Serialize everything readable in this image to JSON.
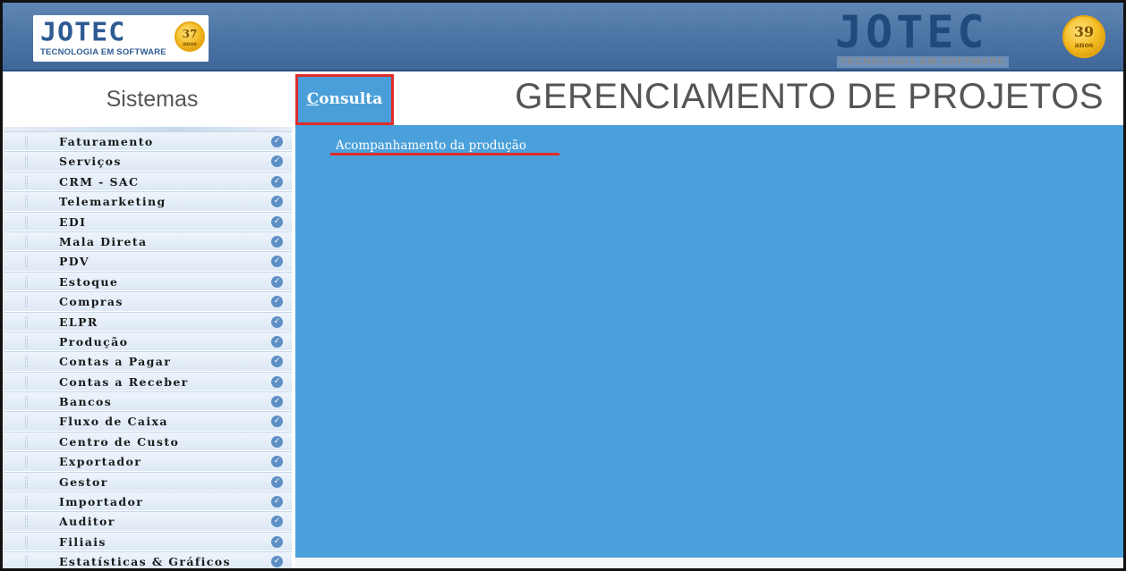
{
  "header": {
    "logo_left": {
      "brand": "JOTEC",
      "tagline": "TECNOLOGIA EM SOFTWARE",
      "badge_number": "37",
      "badge_text": "anos"
    },
    "logo_right": {
      "brand": "JOTEC",
      "tagline": "TECNOLOGIA EM SOFTWARE",
      "badge_number": "39",
      "badge_text": "anos"
    }
  },
  "sidebar": {
    "title": "Sistemas",
    "items": [
      {
        "label": "Faturamento"
      },
      {
        "label": "Serviços"
      },
      {
        "label": "CRM - SAC"
      },
      {
        "label": "Telemarketing"
      },
      {
        "label": "EDI"
      },
      {
        "label": "Mala Direta"
      },
      {
        "label": "PDV"
      },
      {
        "label": "Estoque"
      },
      {
        "label": "Compras"
      },
      {
        "label": "ELPR"
      },
      {
        "label": "Produção"
      },
      {
        "label": "Contas a Pagar"
      },
      {
        "label": "Contas a Receber"
      },
      {
        "label": "Bancos"
      },
      {
        "label": "Fluxo de Caixa"
      },
      {
        "label": "Centro de Custo"
      },
      {
        "label": "Exportador"
      },
      {
        "label": "Gestor"
      },
      {
        "label": "Importador"
      },
      {
        "label": "Auditor"
      },
      {
        "label": "Filiais"
      },
      {
        "label": "Estatísticas & Gráficos"
      }
    ]
  },
  "main": {
    "tab_label_accel": "C",
    "tab_label_rest": "onsulta",
    "page_title": "GERENCIAMENTO DE PROJETOS",
    "links": [
      {
        "label": "Acompanhamento da produção"
      }
    ]
  },
  "colors": {
    "header": "#4b73a3",
    "content_background": "#4aa0da",
    "highlight": "#e12b2b"
  },
  "icons": {
    "menu_item_status": "check-circle-icon",
    "menu_item_grip": "grip-icon"
  }
}
